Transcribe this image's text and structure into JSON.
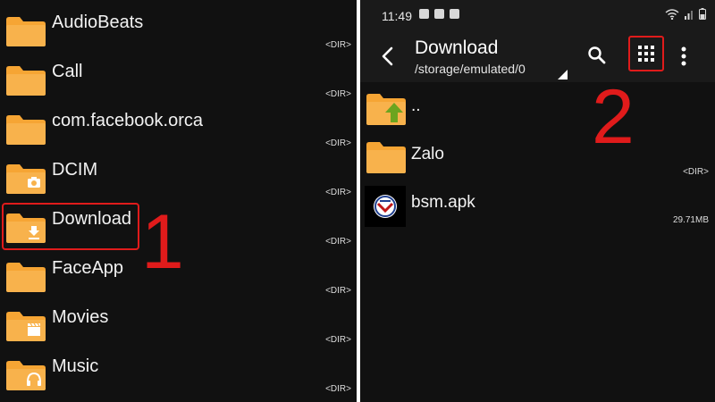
{
  "left_panel": {
    "items": [
      {
        "name": "AudioBeats",
        "type": "<DIR>",
        "badge": "none"
      },
      {
        "name": "Call",
        "type": "<DIR>",
        "badge": "none"
      },
      {
        "name": "com.facebook.orca",
        "type": "<DIR>",
        "badge": "none"
      },
      {
        "name": "DCIM",
        "type": "<DIR>",
        "badge": "camera-icon"
      },
      {
        "name": "Download",
        "type": "<DIR>",
        "badge": "download-icon"
      },
      {
        "name": "FaceApp",
        "type": "<DIR>",
        "badge": "none"
      },
      {
        "name": "Movies",
        "type": "<DIR>",
        "badge": "movie-icon"
      },
      {
        "name": "Music",
        "type": "<DIR>",
        "badge": "headphones-icon"
      }
    ],
    "highlighted_item": "Download",
    "step_number": "1"
  },
  "status_bar": {
    "time": "11:49"
  },
  "toolbar": {
    "title": "Download",
    "path": "/storage/emulated/0",
    "search_icon": "search-icon",
    "grid_icon": "grid-view-icon",
    "more_icon": "more-vert-icon",
    "step_number": "2"
  },
  "right_panel": {
    "items": [
      {
        "name": "..",
        "meta": "",
        "icon": "parent-folder-icon"
      },
      {
        "name": "Zalo",
        "meta": "<DIR>",
        "icon": "folder-icon"
      },
      {
        "name": "bsm.apk",
        "meta": "29.71MB",
        "icon": "apk-icon"
      }
    ]
  },
  "colors": {
    "folder": "#f6a534",
    "highlight": "#e01b1b",
    "background": "#111111",
    "arrow": "#6ca41f"
  }
}
